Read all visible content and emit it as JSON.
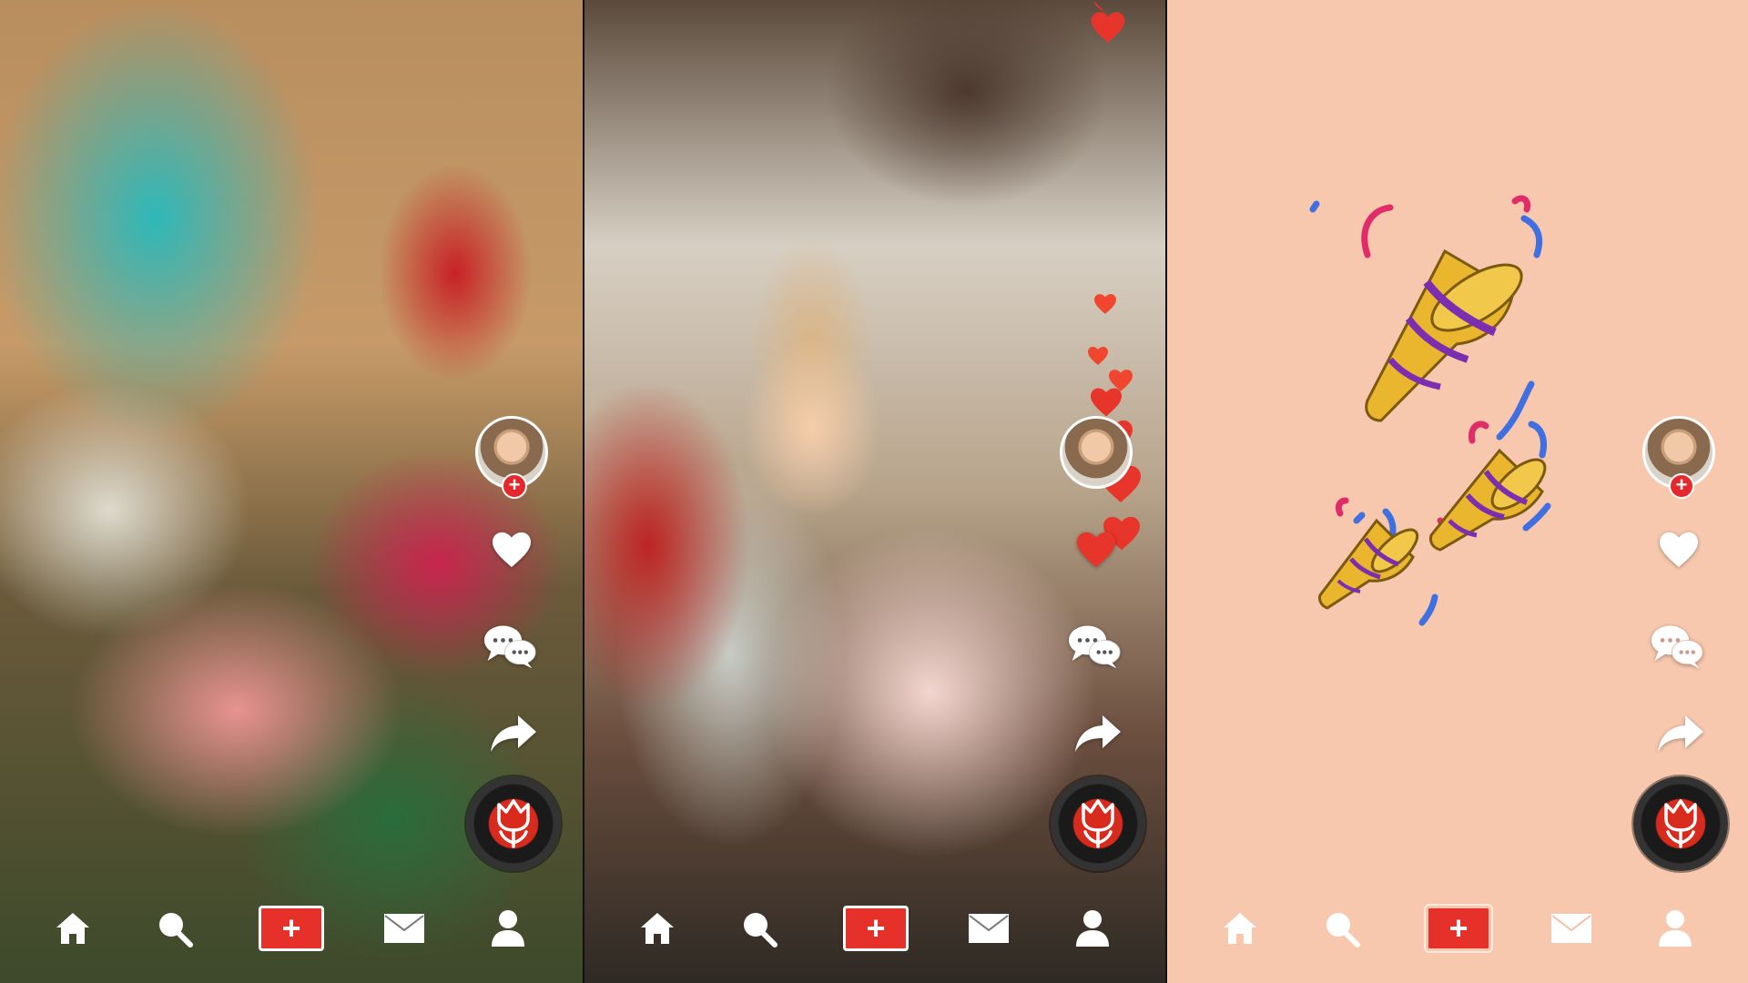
{
  "screens": [
    {
      "name": "video-feed-1",
      "profile_follow_badge": "+",
      "icons": {
        "like": "heart-icon",
        "comment": "comment-bubbles-icon",
        "share": "share-arrow-icon",
        "sound": "tulip-disc-icon"
      }
    },
    {
      "name": "video-feed-2",
      "profile_follow_badge": "+",
      "icons": {
        "like": "heart-icon",
        "comment": "comment-bubbles-icon",
        "share": "share-arrow-icon",
        "sound": "tulip-disc-icon"
      },
      "overlay": "floating-hearts"
    },
    {
      "name": "celebration-screen",
      "profile_follow_badge": "+",
      "icons": {
        "like": "heart-icon",
        "comment": "comment-bubbles-icon",
        "share": "share-arrow-icon",
        "sound": "tulip-disc-icon"
      },
      "overlay": "party-poppers-confetti"
    }
  ],
  "nav": {
    "items": [
      {
        "name": "home",
        "icon": "home-icon"
      },
      {
        "name": "search",
        "icon": "search-icon"
      },
      {
        "name": "create",
        "label": "+"
      },
      {
        "name": "inbox",
        "icon": "mail-icon"
      },
      {
        "name": "profile",
        "icon": "person-icon"
      }
    ]
  },
  "colors": {
    "accent_red": "#e5312a",
    "celebration_bg": "#f7c8ae",
    "icon_white": "#ffffff",
    "heart_red": "#e8352b",
    "confetti_pink": "#e02d6a",
    "confetti_blue": "#3f6fe0",
    "popper_gold": "#e9b62d",
    "popper_purple": "#7b2fb0"
  }
}
